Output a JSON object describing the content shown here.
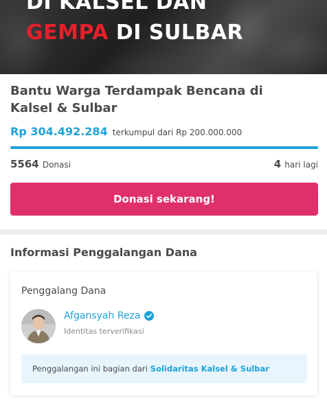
{
  "hero": {
    "line1": "DI KALSEL DAN",
    "line2_red": "GEMPA",
    "line2_white": " DI SULBAR"
  },
  "campaign": {
    "title": "Bantu Warga Terdampak Bencana di Kalsel & Sulbar",
    "amount": "Rp 304.492.284",
    "amount_sub": "terkumpul dari Rp 200.000.000",
    "progress_fraction": 1.0,
    "donations_count": "5564",
    "donations_label": "Donasi",
    "days_left": "4",
    "days_label": "hari lagi",
    "donate_button": "Donasi sekarang!"
  },
  "fundraiser_info": {
    "section_title": "Informasi Penggalangan Dana",
    "box_title": "Penggalang Dana",
    "name": "Afgansyah Reza",
    "verified_text": "Identitas terverifikasi",
    "part_of_prefix": "Penggalangan ini bagian dari",
    "part_of_link": "Solidaritas Kalsel & Sulbar"
  },
  "colors": {
    "accent_blue": "#1ea2d9",
    "button_pink": "#e0306c",
    "hero_red": "#e4202a"
  },
  "icons": {
    "verified": "verified-check-icon"
  }
}
